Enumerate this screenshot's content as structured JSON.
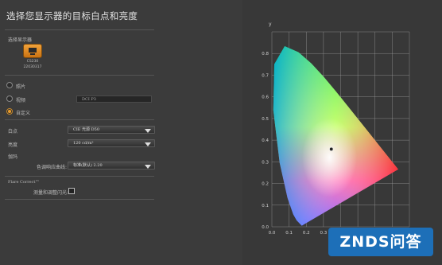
{
  "page": {
    "title": "选择您显示器的目标白点和亮度"
  },
  "display_select": {
    "label": "选择显示器",
    "model": "CS230",
    "serial": "22030317"
  },
  "modes": [
    {
      "label": "照片",
      "checked": false
    },
    {
      "label": "视频",
      "checked": false
    },
    {
      "label": "自定义",
      "checked": true
    }
  ],
  "video_field": {
    "value": "DCI P3"
  },
  "settings": {
    "whitepoint_label": "白点",
    "whitepoint_value": "CIE 光源 D50",
    "brightness_label": "亮度",
    "brightness_value": "120 cd/m²",
    "gamma_section_label": "伽玛",
    "gamma_curve_label": "色调响应曲线:",
    "gamma_curve_value": "标准(默认) 2.20"
  },
  "flare": {
    "title": "Flare Correct™",
    "checkbox_label": "测量和调整闪光:"
  },
  "chart_data": {
    "type": "scatter",
    "title": "",
    "xlabel": "",
    "ylabel": "y",
    "xlim": [
      0.0,
      0.8
    ],
    "ylim": [
      0.0,
      0.9
    ],
    "x_ticks": [
      "0.0",
      "0.1",
      "0.2",
      "0.3",
      "0.4"
    ],
    "y_ticks": [
      "0.0",
      "0.1",
      "0.2",
      "0.3",
      "0.4",
      "0.5",
      "0.6",
      "0.7",
      "0.8"
    ],
    "grid": true,
    "white_point": {
      "x": 0.3457,
      "y": 0.3585
    }
  },
  "watermark": {
    "text": "ZNDS问答"
  }
}
